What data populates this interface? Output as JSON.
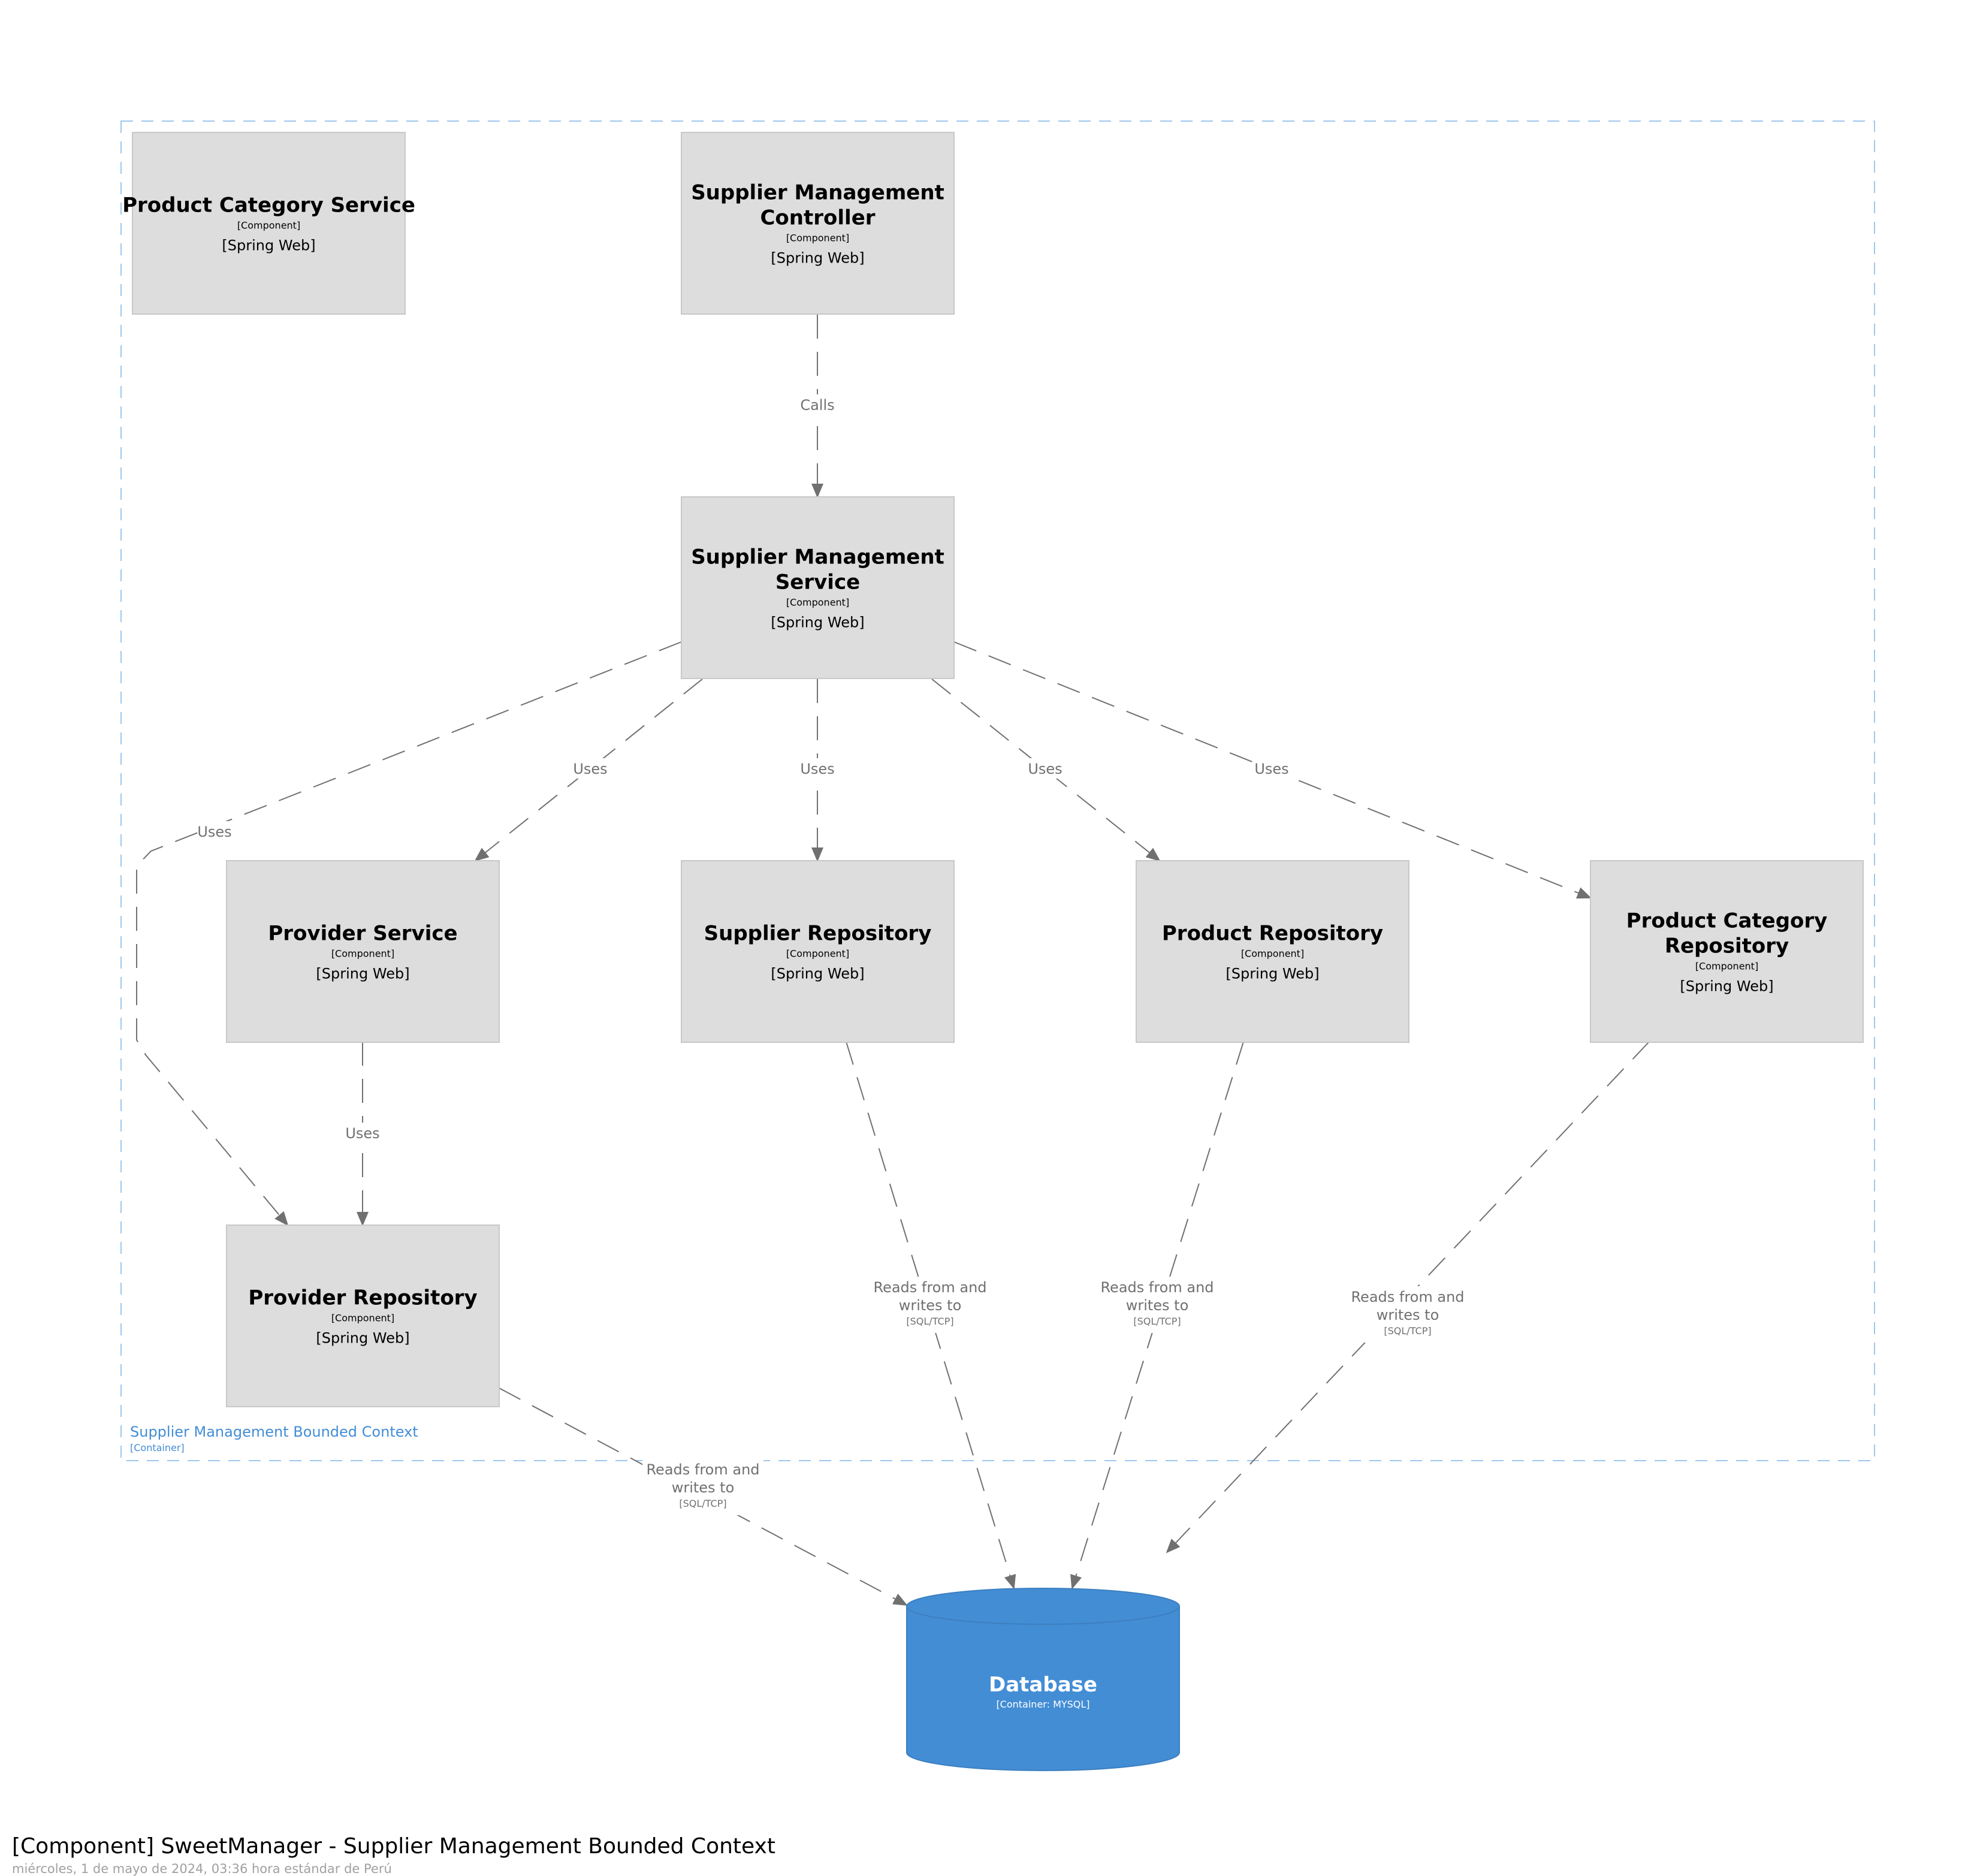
{
  "diagram": {
    "title": "[Component] SweetManager - Supplier Management Bounded Context",
    "date": "miércoles, 1 de mayo de 2024, 03:36 hora estándar de Perú",
    "colors": {
      "component_fill": "#dddddd",
      "component_stroke": "#c8c8c8",
      "relationship": "#707070",
      "container_border": "#9ec7ee",
      "container_label": "#438dd5",
      "database_fill": "#438dd5",
      "database_stroke": "#3c7fc0"
    },
    "container": {
      "name": "Supplier Management Bounded Context",
      "type": "[Container]"
    },
    "components": [
      {
        "id": "pcs",
        "title_lines": [
          "Product Category Service"
        ],
        "type": "[Component]",
        "tech": "[Spring Web]"
      },
      {
        "id": "smc",
        "title_lines": [
          "Supplier Management",
          "Controller"
        ],
        "type": "[Component]",
        "tech": "[Spring Web]"
      },
      {
        "id": "sms",
        "title_lines": [
          "Supplier Management",
          "Service"
        ],
        "type": "[Component]",
        "tech": "[Spring Web]"
      },
      {
        "id": "ps",
        "title_lines": [
          "Provider Service"
        ],
        "type": "[Component]",
        "tech": "[Spring Web]"
      },
      {
        "id": "sr",
        "title_lines": [
          "Supplier Repository"
        ],
        "type": "[Component]",
        "tech": "[Spring Web]"
      },
      {
        "id": "pr",
        "title_lines": [
          "Product Repository"
        ],
        "type": "[Component]",
        "tech": "[Spring Web]"
      },
      {
        "id": "pcr",
        "title_lines": [
          "Product Category",
          "Repository"
        ],
        "type": "[Component]",
        "tech": "[Spring Web]"
      },
      {
        "id": "prr",
        "title_lines": [
          "Provider Repository"
        ],
        "type": "[Component]",
        "tech": "[Spring Web]"
      }
    ],
    "database": {
      "id": "db",
      "title": "Database",
      "type": "[Container: MYSQL]"
    },
    "relationships": [
      {
        "from": "smc",
        "to": "sms",
        "label_lines": [
          "Calls"
        ],
        "tech": ""
      },
      {
        "from": "sms",
        "to": "prr",
        "label_lines": [
          "Uses"
        ],
        "tech": ""
      },
      {
        "from": "sms",
        "to": "ps",
        "label_lines": [
          "Uses"
        ],
        "tech": ""
      },
      {
        "from": "sms",
        "to": "sr",
        "label_lines": [
          "Uses"
        ],
        "tech": ""
      },
      {
        "from": "sms",
        "to": "pr",
        "label_lines": [
          "Uses"
        ],
        "tech": ""
      },
      {
        "from": "sms",
        "to": "pcr",
        "label_lines": [
          "Uses"
        ],
        "tech": ""
      },
      {
        "from": "ps",
        "to": "prr",
        "label_lines": [
          "Uses"
        ],
        "tech": ""
      },
      {
        "from": "sr",
        "to": "db",
        "label_lines": [
          "Reads from and",
          "writes to"
        ],
        "tech": "[SQL/TCP]"
      },
      {
        "from": "pr",
        "to": "db",
        "label_lines": [
          "Reads from and",
          "writes to"
        ],
        "tech": "[SQL/TCP]"
      },
      {
        "from": "pcr",
        "to": "db",
        "label_lines": [
          "Reads from and",
          "writes to"
        ],
        "tech": "[SQL/TCP]"
      },
      {
        "from": "prr",
        "to": "db",
        "label_lines": [
          "Reads from and",
          "writes to"
        ],
        "tech": "[SQL/TCP]"
      }
    ]
  }
}
